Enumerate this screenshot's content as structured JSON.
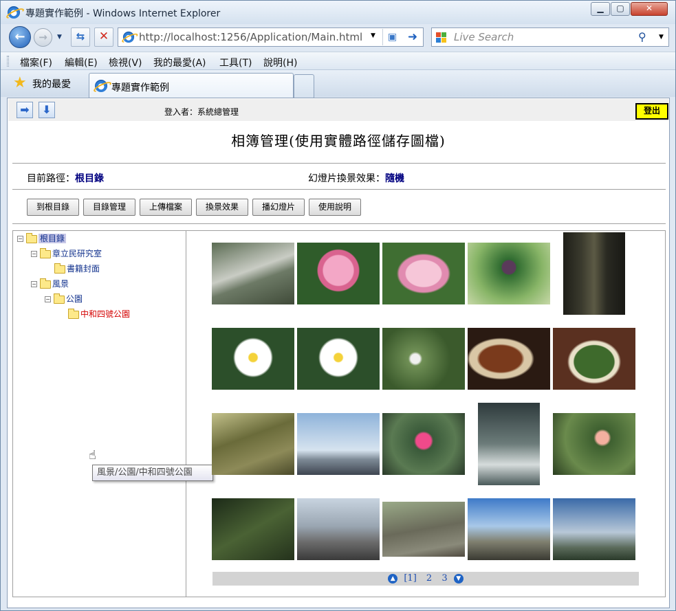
{
  "window": {
    "title": "專題實作範例 - Windows Internet Explorer"
  },
  "nav": {
    "address": "http://localhost:1256/Application/Main.html",
    "search_placeholder": "Live Search"
  },
  "menu": [
    "檔案(F)",
    "編輯(E)",
    "檢視(V)",
    "我的最愛(A)",
    "工具(T)",
    "說明(H)"
  ],
  "tabs": {
    "favorites_label": "我的最愛",
    "active_tab": "專題實作範例"
  },
  "page": {
    "user_label": "登入者：系統總管理",
    "logout": "登出",
    "title": "相簿管理(使用實體路徑儲存圖檔)",
    "path_label": "目前路徑：",
    "path_value": "根目錄",
    "effect_label": "幻燈片換景效果：",
    "effect_value": "隨機",
    "buttons": [
      "到根目錄",
      "目錄管理",
      "上傳檔案",
      "換景效果",
      "播幻燈片",
      "使用說明"
    ]
  },
  "tree": {
    "root": "根目錄",
    "lab": "章立民研究室",
    "covers": "書籍封面",
    "scenery": "風景",
    "park": "公園",
    "zhonghe": "中和四號公園"
  },
  "tooltip": "風景/公園/中和四號公園",
  "pager": {
    "pages": [
      "[1]",
      "2",
      "3"
    ]
  },
  "photos": [
    {
      "subject": "stream"
    },
    {
      "subject": "pink-lotus-bud"
    },
    {
      "subject": "pink-lotus"
    },
    {
      "subject": "lotus-seedpod"
    },
    {
      "subject": "tree-trunk"
    },
    {
      "subject": "white-lily"
    },
    {
      "subject": "white-lily"
    },
    {
      "subject": "butterfly"
    },
    {
      "subject": "braised-pork"
    },
    {
      "subject": "greens-soup"
    },
    {
      "subject": "park-rocks"
    },
    {
      "subject": "city-skyline"
    },
    {
      "subject": "pink-waterlily"
    },
    {
      "subject": "egret-waterfall"
    },
    {
      "subject": "lantana-flowers"
    },
    {
      "subject": "insect-on-plant"
    },
    {
      "subject": "city-street"
    },
    {
      "subject": "fallen-tree"
    },
    {
      "subject": "street-view"
    },
    {
      "subject": "sky-landscape"
    }
  ]
}
